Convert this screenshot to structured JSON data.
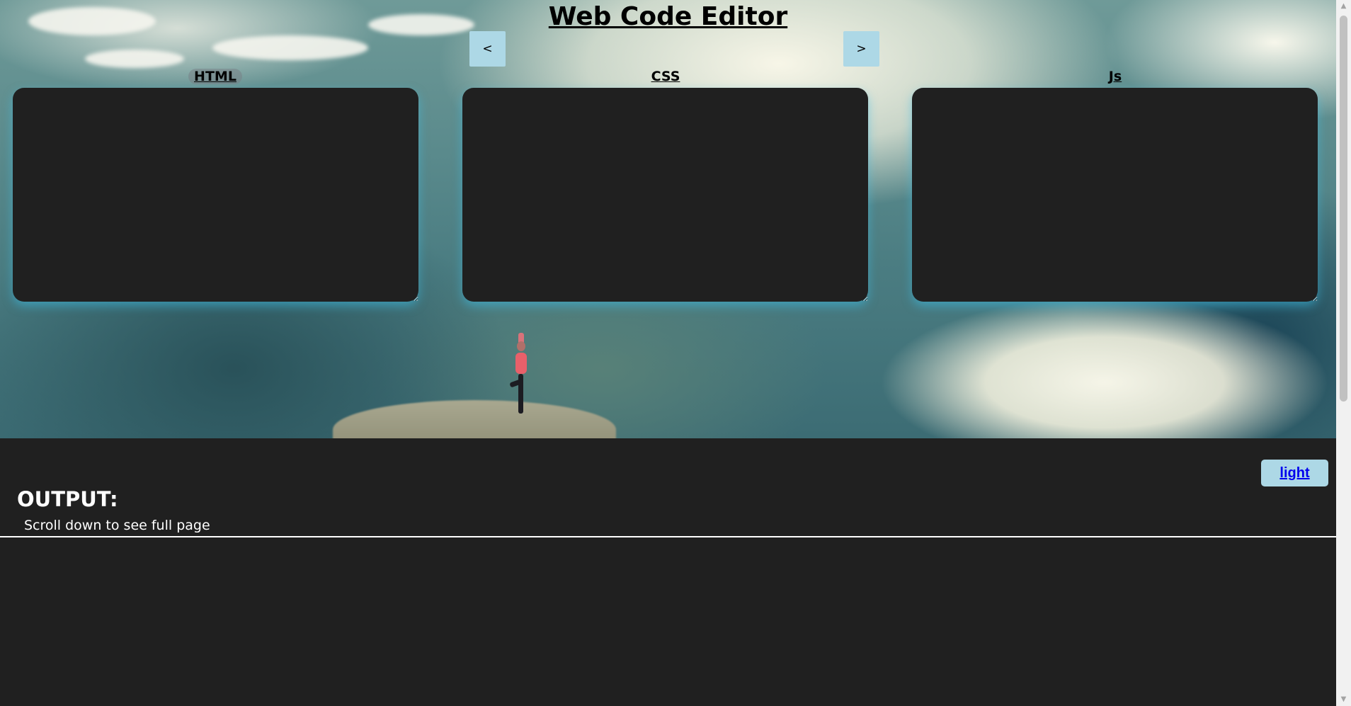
{
  "header": {
    "title": "Web Code Editor",
    "prev_label": "<",
    "next_label": ">"
  },
  "editors": {
    "html_label": "HTML",
    "css_label": "CSS",
    "js_label": "Js",
    "html_value": "",
    "css_value": "",
    "js_value": ""
  },
  "output": {
    "theme_toggle_label": "light",
    "title": "OUTPUT:",
    "hint": "Scroll down to see full page"
  },
  "colors": {
    "button_bg": "#add8e6",
    "editor_bg": "#202020",
    "page_bg": "#202020",
    "link": "#0000ee"
  },
  "icons": {
    "scroll_up": "scroll-up-arrow-icon",
    "scroll_down": "scroll-down-arrow-icon"
  }
}
